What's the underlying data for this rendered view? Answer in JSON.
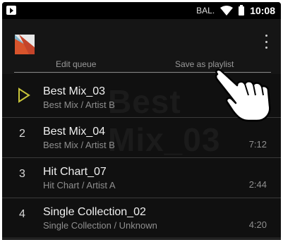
{
  "status_bar": {
    "carrier": "BAL.",
    "time": "10:08"
  },
  "header": {
    "album_icon": "album-art-icon",
    "menu_icon": "more-vert-icon"
  },
  "actions": {
    "edit_queue": "Edit queue",
    "save_as_playlist": "Save as playlist"
  },
  "watermark": "Best Mix_03",
  "queue": [
    {
      "number": "",
      "title": "Best Mix_03",
      "subtitle": "Best Mix / Artist B",
      "duration": "",
      "playing": true
    },
    {
      "number": "2",
      "title": "Best Mix_04",
      "subtitle": "Best Mix / Artist B",
      "duration": "7:12",
      "playing": false
    },
    {
      "number": "3",
      "title": "Hit Chart_07",
      "subtitle": "Hit Chart / Artist A",
      "duration": "2:44",
      "playing": false
    },
    {
      "number": "4",
      "title": "Single Collection_02",
      "subtitle": "Single Collection / Unknown",
      "duration": "4:20",
      "playing": false
    }
  ],
  "colors": {
    "accent": "#c8c43a",
    "background": "#101010",
    "text": "#f0f0f0",
    "secondary_text": "#8f8f8f"
  }
}
